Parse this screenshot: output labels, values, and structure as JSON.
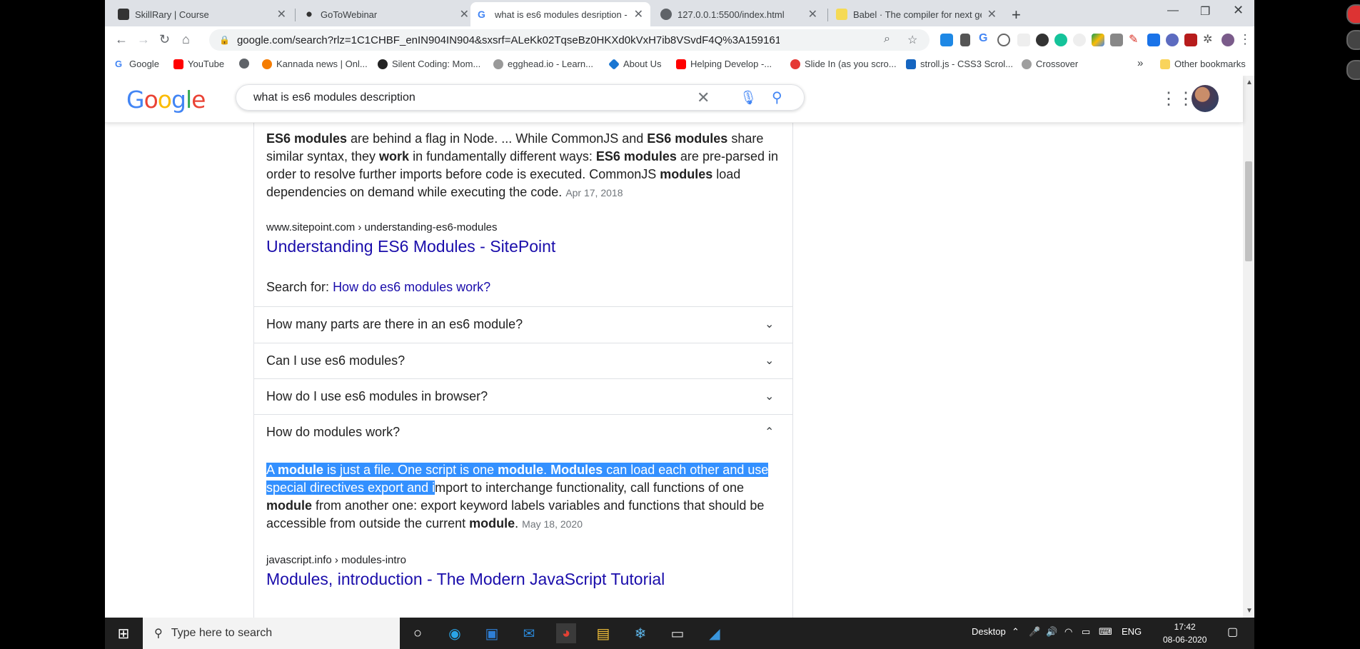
{
  "tabs": [
    {
      "title": "SkillRary | Course",
      "active": false
    },
    {
      "title": "GoToWebinar",
      "active": false
    },
    {
      "title": "what is es6 modules desription -",
      "active": true
    },
    {
      "title": "127.0.0.1:5500/index.html",
      "active": false
    },
    {
      "title": "Babel · The compiler for next gen",
      "active": false
    }
  ],
  "address": {
    "url": "google.com/search?rlz=1C1CHBF_enIN904IN904&sxsrf=ALeKk02TqseBz0HKXd0kVxH7ib8VSvdF4Q%3A159161704..."
  },
  "bookmarks": [
    "Google",
    "YouTube",
    "",
    "Kannada news | Onl...",
    "Silent Coding: Mom...",
    "egghead.io - Learn...",
    "About Us",
    "Helping Develop -...",
    "Slide In (as you scro...",
    "stroll.js - CSS3 Scrol...",
    "Crossover"
  ],
  "other_bookmarks": "Other bookmarks",
  "search": {
    "query": "what is es6 modules description"
  },
  "result1": {
    "snippet_parts": [
      {
        "b": true,
        "t": "ES6 modules"
      },
      {
        "b": false,
        "t": " are behind a flag in Node. ... While CommonJS and "
      },
      {
        "b": true,
        "t": "ES6 modules"
      },
      {
        "b": false,
        "t": " share similar syntax, they "
      },
      {
        "b": true,
        "t": "work"
      },
      {
        "b": false,
        "t": " in fundamentally different ways: "
      },
      {
        "b": true,
        "t": "ES6 modules"
      },
      {
        "b": false,
        "t": " are pre-parsed in order to resolve further imports before code is executed. CommonJS "
      },
      {
        "b": true,
        "t": "modules"
      },
      {
        "b": false,
        "t": " load dependencies on demand while executing the code. "
      }
    ],
    "date": "Apr 17, 2018",
    "cite": "www.sitepoint.com › understanding-es6-modules",
    "title": "Understanding ES6 Modules - SitePoint",
    "search_for_label": "Search for:",
    "search_for_link": "How do es6 modules work?"
  },
  "faq": [
    {
      "q": "How many parts are there in an es6 module?",
      "expanded": false
    },
    {
      "q": "Can I use es6 modules?",
      "expanded": false
    },
    {
      "q": "How do I use es6 modules in browser?",
      "expanded": false
    },
    {
      "q": "How do modules work?",
      "expanded": true
    }
  ],
  "answer": {
    "highlighted_parts": [
      {
        "b": false,
        "t": "A "
      },
      {
        "b": true,
        "t": "module"
      },
      {
        "b": false,
        "t": " is just a file. One script is one "
      },
      {
        "b": true,
        "t": "module"
      },
      {
        "b": false,
        "t": ". "
      },
      {
        "b": true,
        "t": "Modules"
      },
      {
        "b": false,
        "t": " can load each other and use special directives export and i"
      }
    ],
    "rest_parts": [
      {
        "b": false,
        "t": "mport to interchange functionality, call functions of one "
      },
      {
        "b": true,
        "t": "module"
      },
      {
        "b": false,
        "t": " from another one: export keyword labels variables and functions that should be accessible from outside the current "
      },
      {
        "b": true,
        "t": "module"
      },
      {
        "b": false,
        "t": ". "
      }
    ],
    "date": "May 18, 2020",
    "cite": "javascript.info › modules-intro",
    "title": "Modules, introduction - The Modern JavaScript Tutorial"
  },
  "taskbar": {
    "search_placeholder": "Type here to search",
    "desktop_label": "Desktop",
    "lang": "ENG",
    "time": "17:42",
    "date": "08-06-2020"
  },
  "colors": {
    "link": "#1a0dab",
    "highlight": "#3390ff",
    "google_blue": "#4285f4",
    "google_red": "#ea4335",
    "google_yellow": "#fbbc05",
    "google_green": "#34a853"
  }
}
